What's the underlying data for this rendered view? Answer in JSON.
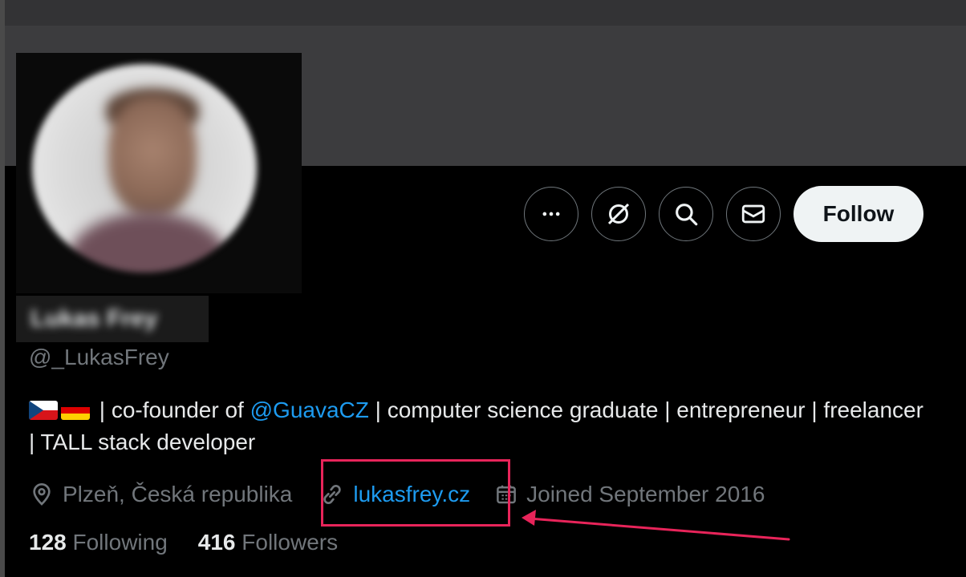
{
  "profile": {
    "handle": "@_LukasFrey",
    "display_name": "Lukas Frey"
  },
  "actions": {
    "more_icon": "more-horizontal-icon",
    "grok_icon": "grok-icon",
    "search_icon": "search-icon",
    "message_icon": "mail-icon",
    "follow_label": "Follow"
  },
  "bio": {
    "flags": [
      "cz-flag",
      "de-flag"
    ],
    "text_before_mention": "| co-founder of ",
    "mention": "@GuavaCZ",
    "text_after_mention": " | computer science graduate | entrepreneur | freelancer | TALL stack developer"
  },
  "meta": {
    "location": "Plzeň, Česká republika",
    "website": "lukasfrey.cz",
    "joined": "Joined September 2016"
  },
  "stats": {
    "following_count": "128",
    "following_label": "Following",
    "followers_count": "416",
    "followers_label": "Followers"
  },
  "colors": {
    "accent": "#1d9bf0",
    "highlight": "#e8245a",
    "background": "#000000",
    "muted_text": "#71767b"
  }
}
